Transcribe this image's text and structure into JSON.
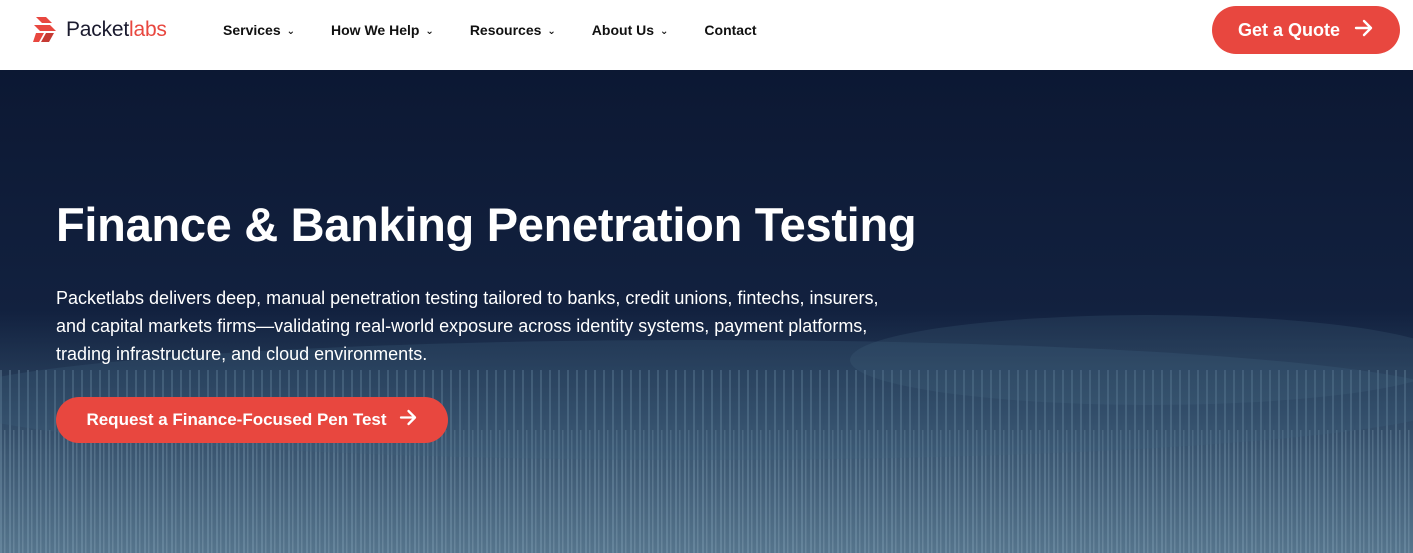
{
  "brand": {
    "name_part1": "Packet",
    "name_part2": "labs",
    "accent_color": "#e8473f",
    "logo_icon": "packetlabs-logo-icon"
  },
  "nav": {
    "items": [
      {
        "label": "Services",
        "has_dropdown": true
      },
      {
        "label": "How We Help",
        "has_dropdown": true
      },
      {
        "label": "Resources",
        "has_dropdown": true
      },
      {
        "label": "About Us",
        "has_dropdown": true
      },
      {
        "label": "Contact",
        "has_dropdown": false
      }
    ],
    "chevron_glyph": "⌄"
  },
  "header_cta": {
    "label": "Get a Quote",
    "icon": "arrow-right-icon"
  },
  "hero": {
    "title": "Finance & Banking Penetration Testing",
    "description": "Packetlabs delivers deep, manual penetration testing tailored to banks, credit unions, fintechs, insurers, and capital markets firms—validating real-world exposure across identity systems, payment platforms, trading infrastructure, and cloud environments.",
    "cta_label": "Request a Finance-Focused Pen Test",
    "cta_icon": "arrow-right-icon",
    "background_color": "#0f1d3a"
  }
}
